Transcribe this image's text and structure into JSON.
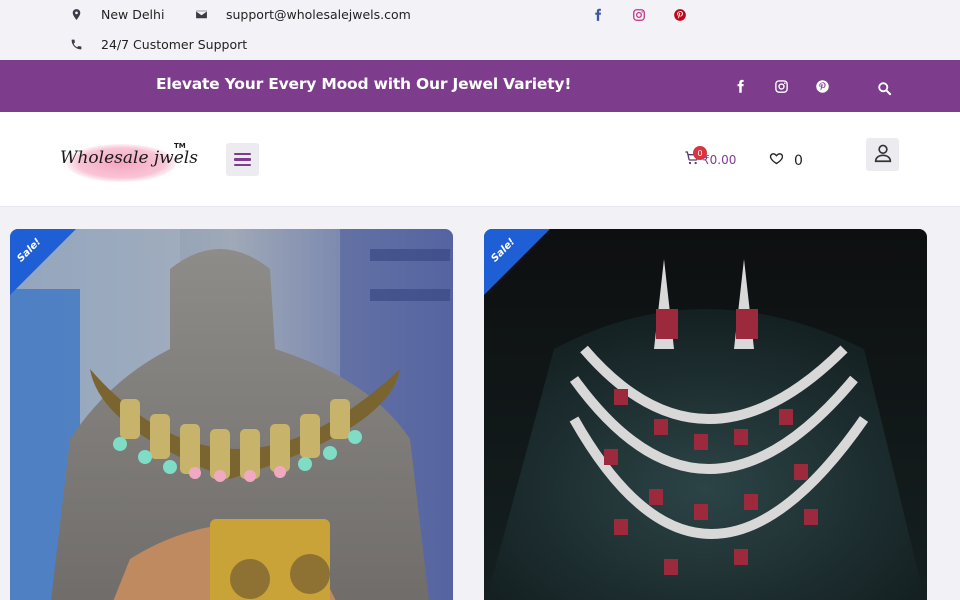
{
  "topbar": {
    "location": "New Delhi",
    "email": "support@wholesalejwels.com",
    "support": "24/7 Customer Support",
    "social": [
      {
        "icon": "facebook-icon",
        "color": "#3b5998"
      },
      {
        "icon": "instagram-icon",
        "color": "#c13584"
      },
      {
        "icon": "pinterest-icon",
        "color": "#bd081c"
      }
    ]
  },
  "banner": {
    "text": "Elevate Your Every Mood with Our Jewel Variety!",
    "background": "#7d3d8c",
    "icons": [
      "facebook-icon",
      "instagram-icon",
      "pinterest-icon",
      "search-icon"
    ]
  },
  "header": {
    "logo_text": "Wholesale jwels",
    "logo_tm": "TM",
    "cart_count": "0",
    "cart_amount": "₹0.00",
    "wishlist_count": "0"
  },
  "products": [
    {
      "badge": "Sale!",
      "image": "kundan-choker-necklace"
    },
    {
      "badge": "Sale!",
      "image": "ruby-diamond-layered-necklace-set"
    }
  ],
  "colors": {
    "accent": "#7d3d8c",
    "sale_badge": "#1f5fd6",
    "cart_badge": "#d9343f"
  }
}
